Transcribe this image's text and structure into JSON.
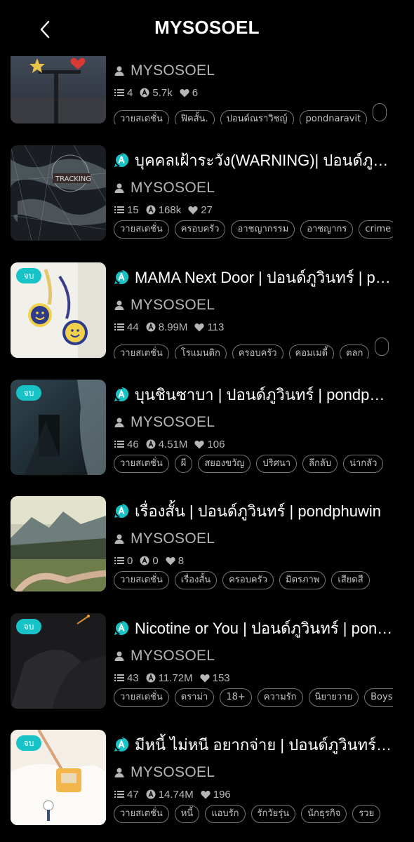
{
  "header": {
    "title": "MYSOSOEL",
    "back_icon": "chevron-left-icon"
  },
  "colors": {
    "accent": "#17c3c7",
    "background": "#000000",
    "muted": "#b6b6b6"
  },
  "items": [
    {
      "title": "",
      "author": "MYSOSOEL",
      "chapters": "4",
      "views": "5.7k",
      "likes": "6",
      "badge": "",
      "tags": [
        "วายสเตชั่น",
        "ฟิคสั้น.",
        "ปอนด์ณราวิชญ์",
        "pondnaravit",
        ""
      ]
    },
    {
      "title": "บุคคลเฝ้าระวัง(WARNING)| ปอนด์ภูวินทร์ | pondphuwin",
      "author": "MYSOSOEL",
      "chapters": "15",
      "views": "168k",
      "likes": "27",
      "badge": "",
      "tags": [
        "วายสเตชั่น",
        "ครอบครัว",
        "อาชญากรรม",
        "อาชญากร",
        "crime"
      ]
    },
    {
      "title": "MAMA Next Door | ปอนด์ภูวินทร์ | pondphuwin",
      "author": "MYSOSOEL",
      "chapters": "44",
      "views": "8.99M",
      "likes": "113",
      "badge": "จบ",
      "tags": [
        "วายสเตชั่น",
        "โรแมนติก",
        "ครอบครัว",
        "คอมเมดี้",
        "ตลก",
        ""
      ]
    },
    {
      "title": "บุนชินซาบา | ปอนด์ภูวินทร์ | pondphuwin",
      "author": "MYSOSOEL",
      "chapters": "46",
      "views": "4.51M",
      "likes": "106",
      "badge": "จบ",
      "tags": [
        "วายสเตชั่น",
        "ผี",
        "สยองขวัญ",
        "ปริศนา",
        "ลึกลับ",
        "น่ากลัว"
      ]
    },
    {
      "title": "เรื่องสั้น | ปอนด์ภูวินทร์ | pondphuwin",
      "author": "MYSOSOEL",
      "chapters": "0",
      "views": "0",
      "likes": "8",
      "badge": "",
      "tags": [
        "วายสเตชั่น",
        "เรื่องสั้น",
        "ครอบครัว",
        "มิตรภาพ",
        "เสียดสี"
      ]
    },
    {
      "title": "Nicotine or You | ปอนด์ภูวินทร์ | pondphuwin",
      "author": "MYSOSOEL",
      "chapters": "43",
      "views": "11.72M",
      "likes": "153",
      "badge": "จบ",
      "tags": [
        "วายสเตชั่น",
        "ดราม่า",
        "18+",
        "ความรัก",
        "นิยายวาย",
        "Boys Love"
      ]
    },
    {
      "title": "มีหนี้ ไม่หนี อยากจ่าย | ปอนด์ภูวินทร์ | pondphuwin",
      "author": "MYSOSOEL",
      "chapters": "47",
      "views": "14.74M",
      "likes": "196",
      "badge": "จบ",
      "tags": [
        "วายสเตชั่น",
        "หนี้",
        "แอบรัก",
        "รักวัยรุ่น",
        "นักธุรกิจ",
        "รวย"
      ]
    }
  ]
}
